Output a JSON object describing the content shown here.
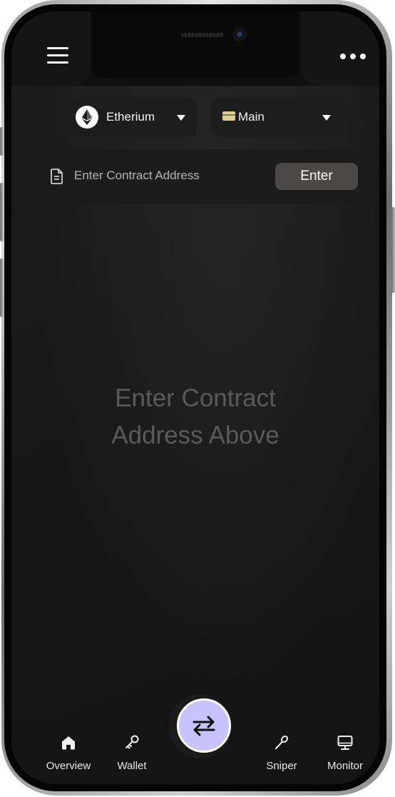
{
  "header": {
    "menu_icon": "hamburger-icon",
    "more_icon": "more-horizontal-icon"
  },
  "selectors": {
    "network": {
      "label": "Etherium",
      "icon": "ethereum-icon"
    },
    "wallet": {
      "label": "Main",
      "icon": "wallet-card-icon"
    }
  },
  "contract": {
    "placeholder": "Enter Contract Address",
    "icon": "document-icon",
    "button_label": "Enter"
  },
  "empty_state": {
    "line1": "Enter Contract",
    "line2": "Address Above"
  },
  "nav": {
    "items": [
      {
        "label": "Overview",
        "icon": "home-icon"
      },
      {
        "label": "Wallet",
        "icon": "key-icon"
      },
      {
        "label": "Sniper",
        "icon": "sniper-icon"
      },
      {
        "label": "Monitor",
        "icon": "monitor-icon"
      }
    ],
    "center_icon": "swap-arrows-icon"
  },
  "colors": {
    "accent": "#c8c2ff",
    "background": "#181818",
    "button": "#4a4947"
  }
}
